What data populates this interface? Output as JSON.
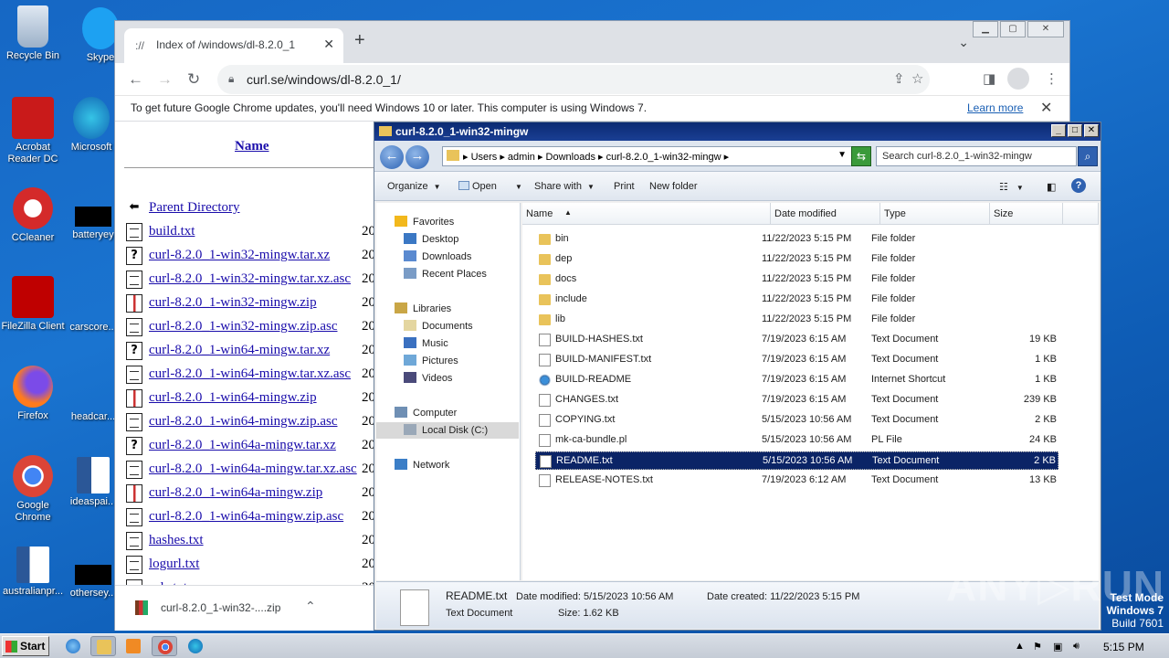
{
  "desktop": {
    "icons": [
      {
        "label": "Recycle Bin"
      },
      {
        "label": "Skype"
      },
      {
        "label": "Acrobat Reader DC"
      },
      {
        "label": "Microsoft"
      },
      {
        "label": "CCleaner"
      },
      {
        "label": "batteryey"
      },
      {
        "label": "FileZilla Client"
      },
      {
        "label": "carscore..."
      },
      {
        "label": "Firefox"
      },
      {
        "label": "headcar..."
      },
      {
        "label": "Google Chrome"
      },
      {
        "label": "ideaspai..."
      },
      {
        "label": "australianpr..."
      },
      {
        "label": "othersey..."
      }
    ]
  },
  "chrome": {
    "tab_title": "Index of /windows/dl-8.2.0_1",
    "url": "curl.se/windows/dl-8.2.0_1/",
    "infobar": {
      "message": "To get future Google Chrome updates, you'll need Windows 10 or later. This computer is using Windows 7.",
      "learn_more": "Learn more"
    },
    "page": {
      "name_header": "Name",
      "files": [
        {
          "name": "Parent Directory",
          "icon": "back",
          "date": ""
        },
        {
          "name": "build.txt",
          "icon": "txt",
          "date": "20"
        },
        {
          "name": "curl-8.2.0_1-win32-mingw.tar.xz",
          "icon": "unknown",
          "date": "20"
        },
        {
          "name": "curl-8.2.0_1-win32-mingw.tar.xz.asc",
          "icon": "txt",
          "date": "20"
        },
        {
          "name": "curl-8.2.0_1-win32-mingw.zip",
          "icon": "zip",
          "date": "20"
        },
        {
          "name": "curl-8.2.0_1-win32-mingw.zip.asc",
          "icon": "txt",
          "date": "20"
        },
        {
          "name": "curl-8.2.0_1-win64-mingw.tar.xz",
          "icon": "unknown",
          "date": "20"
        },
        {
          "name": "curl-8.2.0_1-win64-mingw.tar.xz.asc",
          "icon": "txt",
          "date": "20"
        },
        {
          "name": "curl-8.2.0_1-win64-mingw.zip",
          "icon": "zip",
          "date": "20"
        },
        {
          "name": "curl-8.2.0_1-win64-mingw.zip.asc",
          "icon": "txt",
          "date": "20"
        },
        {
          "name": "curl-8.2.0_1-win64a-mingw.tar.xz",
          "icon": "unknown",
          "date": "20"
        },
        {
          "name": "curl-8.2.0_1-win64a-mingw.tar.xz.asc",
          "icon": "txt",
          "date": "20"
        },
        {
          "name": "curl-8.2.0_1-win64a-mingw.zip",
          "icon": "zip",
          "date": "20"
        },
        {
          "name": "curl-8.2.0_1-win64a-mingw.zip.asc",
          "icon": "txt",
          "date": "20"
        },
        {
          "name": "hashes.txt",
          "icon": "txt",
          "date": "20"
        },
        {
          "name": "logurl.txt",
          "icon": "txt",
          "date": "20"
        },
        {
          "name": "urls.txt",
          "icon": "txt",
          "date": "20"
        }
      ]
    },
    "download": {
      "name": "curl-8.2.0_1-win32-....zip"
    }
  },
  "explorer": {
    "title": "curl-8.2.0_1-win32-mingw",
    "breadcrumb": "▸ Users ▸ admin ▸ Downloads ▸ curl-8.2.0_1-win32-mingw ▸",
    "search_placeholder": "Search curl-8.2.0_1-win32-mingw",
    "commands": [
      "Organize",
      "Open",
      "Share with",
      "Print",
      "New folder"
    ],
    "nav": [
      {
        "label": "Favorites",
        "icon": "star-icon",
        "indent": 0
      },
      {
        "label": "Desktop",
        "icon": "desktop-icon",
        "indent": 1
      },
      {
        "label": "Downloads",
        "icon": "downloads-icon",
        "indent": 1
      },
      {
        "label": "Recent Places",
        "icon": "recent-places-icon",
        "indent": 1
      },
      {
        "label": "Libraries",
        "icon": "libraries-icon",
        "indent": 0
      },
      {
        "label": "Documents",
        "icon": "documents-icon",
        "indent": 1
      },
      {
        "label": "Music",
        "icon": "music-icon",
        "indent": 1
      },
      {
        "label": "Pictures",
        "icon": "pictures-icon",
        "indent": 1
      },
      {
        "label": "Videos",
        "icon": "videos-icon",
        "indent": 1
      },
      {
        "label": "Computer",
        "icon": "computer-icon",
        "indent": 0
      },
      {
        "label": "Local Disk (C:)",
        "icon": "disk-icon",
        "indent": 1
      },
      {
        "label": "Network",
        "icon": "network-icon",
        "indent": 0
      }
    ],
    "columns": [
      "Name",
      "Date modified",
      "Type",
      "Size"
    ],
    "rows": [
      {
        "name": "bin",
        "date": "11/22/2023 5:15 PM",
        "type": "File folder",
        "size": "",
        "icon": "folder"
      },
      {
        "name": "dep",
        "date": "11/22/2023 5:15 PM",
        "type": "File folder",
        "size": "",
        "icon": "folder"
      },
      {
        "name": "docs",
        "date": "11/22/2023 5:15 PM",
        "type": "File folder",
        "size": "",
        "icon": "folder"
      },
      {
        "name": "include",
        "date": "11/22/2023 5:15 PM",
        "type": "File folder",
        "size": "",
        "icon": "folder"
      },
      {
        "name": "lib",
        "date": "11/22/2023 5:15 PM",
        "type": "File folder",
        "size": "",
        "icon": "folder"
      },
      {
        "name": "BUILD-HASHES.txt",
        "date": "7/19/2023 6:15 AM",
        "type": "Text Document",
        "size": "19 KB",
        "icon": "doc"
      },
      {
        "name": "BUILD-MANIFEST.txt",
        "date": "7/19/2023 6:15 AM",
        "type": "Text Document",
        "size": "1 KB",
        "icon": "doc"
      },
      {
        "name": "BUILD-README",
        "date": "7/19/2023 6:15 AM",
        "type": "Internet Shortcut",
        "size": "1 KB",
        "icon": "link"
      },
      {
        "name": "CHANGES.txt",
        "date": "7/19/2023 6:15 AM",
        "type": "Text Document",
        "size": "239 KB",
        "icon": "doc"
      },
      {
        "name": "COPYING.txt",
        "date": "5/15/2023 10:56 AM",
        "type": "Text Document",
        "size": "2 KB",
        "icon": "doc"
      },
      {
        "name": "mk-ca-bundle.pl",
        "date": "5/15/2023 10:56 AM",
        "type": "PL File",
        "size": "24 KB",
        "icon": "doc"
      },
      {
        "name": "README.txt",
        "date": "5/15/2023 10:56 AM",
        "type": "Text Document",
        "size": "2 KB",
        "icon": "doc",
        "selected": true
      },
      {
        "name": "RELEASE-NOTES.txt",
        "date": "7/19/2023 6:12 AM",
        "type": "Text Document",
        "size": "13 KB",
        "icon": "doc"
      }
    ],
    "details": {
      "name": "README.txt",
      "modified": "Date modified: 5/15/2023 10:56 AM",
      "created": "Date created: 11/22/2023 5:15 PM",
      "type": "Text Document",
      "size": "Size: 1.62 KB"
    }
  },
  "taskbar": {
    "start": "Start",
    "clock": "5:15 PM"
  },
  "watermark": "ANY▷RUN",
  "testmode": {
    "line1": "Test Mode",
    "line2": "Windows 7",
    "line3": "Build 7601"
  }
}
